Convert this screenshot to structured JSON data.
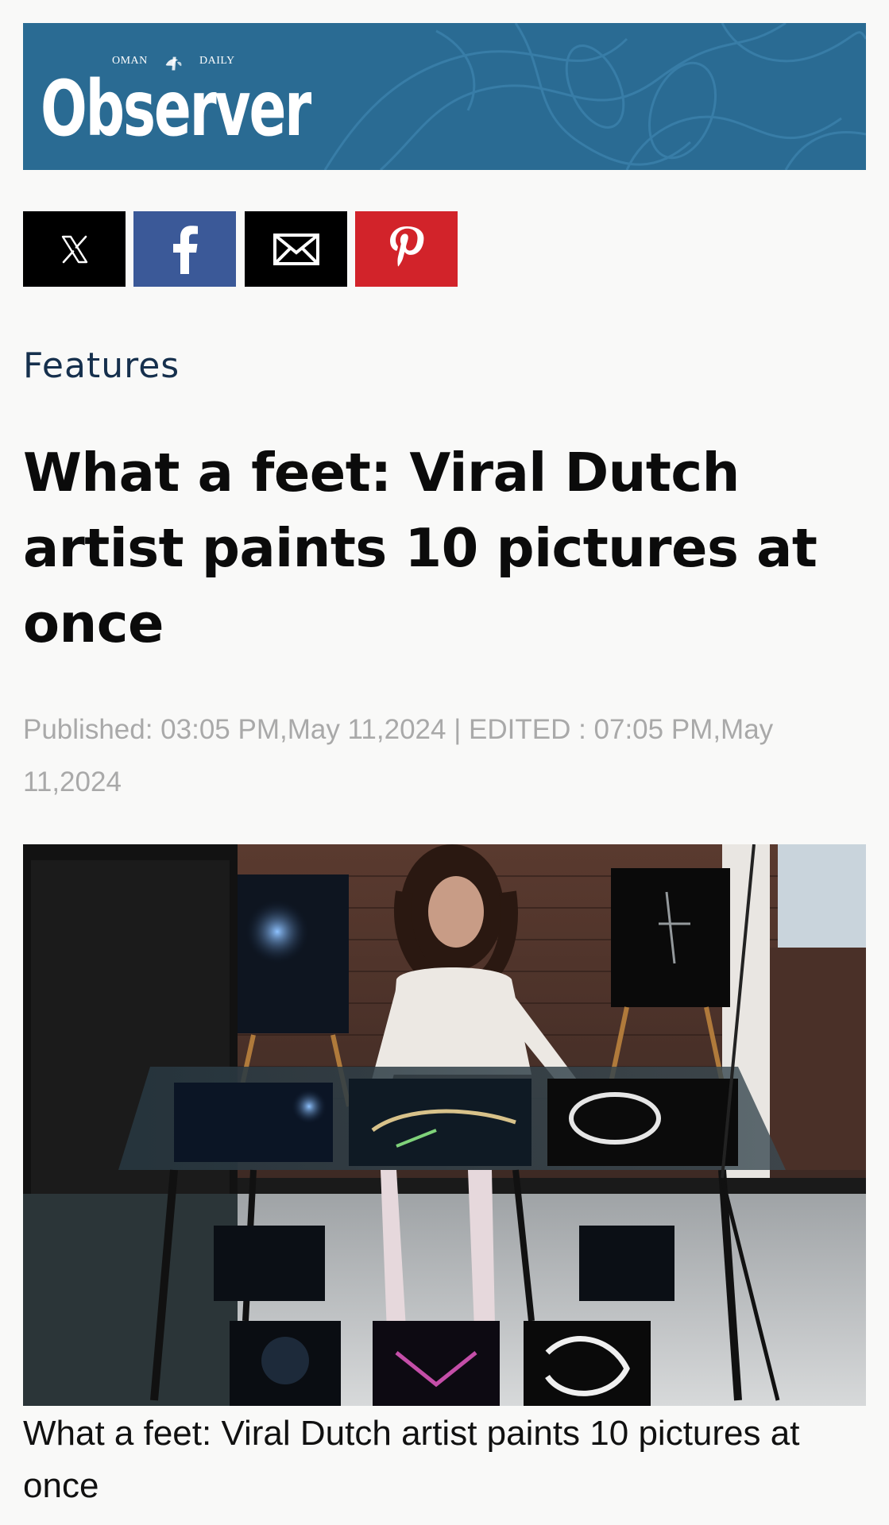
{
  "masthead": {
    "logo_top_left": "OMAN",
    "logo_top_right": "DAILY",
    "logo_word": "Observer"
  },
  "share": {
    "buttons": [
      {
        "name": "x",
        "icon": "x-logo-icon",
        "color": "#000000"
      },
      {
        "name": "facebook",
        "icon": "facebook-icon",
        "color": "#3b5998"
      },
      {
        "name": "email",
        "icon": "mail-icon",
        "color": "#000000"
      },
      {
        "name": "pinterest",
        "icon": "pinterest-icon",
        "color": "#d2232a"
      }
    ]
  },
  "article": {
    "category": "Features",
    "headline": "What a feet: Viral Dutch artist paints 10 pictures at once",
    "published_line": "Published: 03:05 PM,May 11,2024 | EDITED : 07:05 PM,May 11,2024",
    "image_caption": "What a feet: Viral Dutch artist paints 10 pictures at once"
  },
  "colors": {
    "masthead_bg": "#2a6b93",
    "category_text": "#16304d",
    "meta_text": "#a9a9a9"
  }
}
